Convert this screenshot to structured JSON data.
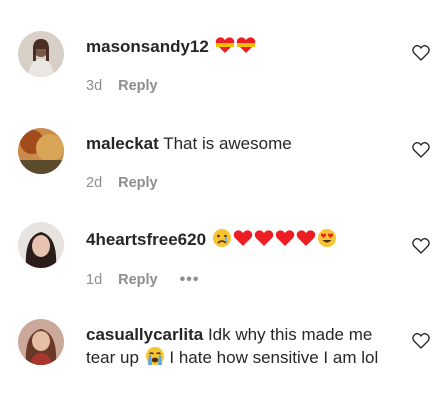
{
  "comments": [
    {
      "username": "masonsandy12",
      "text": "",
      "emojis": [
        "heart-ribbon",
        "heart-ribbon"
      ],
      "time": "3d",
      "reply_label": "Reply",
      "more_label": "",
      "avatar_color": "#c9b8a8"
    },
    {
      "username": "maleckat",
      "text": "That is awesome",
      "emojis": [],
      "time": "2d",
      "reply_label": "Reply",
      "more_label": "",
      "avatar_color": "#a8692f"
    },
    {
      "username": "4heartsfree620",
      "text": "",
      "emojis": [
        "sad-face",
        "red-heart",
        "red-heart",
        "red-heart",
        "red-heart",
        "heart-eyes"
      ],
      "time": "1d",
      "reply_label": "Reply",
      "more_label": "•••",
      "avatar_color": "#6b5a55"
    },
    {
      "username": "casuallycarlita",
      "text_part1": "Idk why this made me tear up",
      "text_part2": "I hate how sensitive I am lol",
      "emojis": [
        "crying-face"
      ],
      "time": "",
      "reply_label": "",
      "more_label": "",
      "avatar_color": "#b07f6e"
    }
  ],
  "colors": {
    "username": "#262626",
    "meta": "#8e8e8e",
    "heart": "#ed1d24"
  }
}
